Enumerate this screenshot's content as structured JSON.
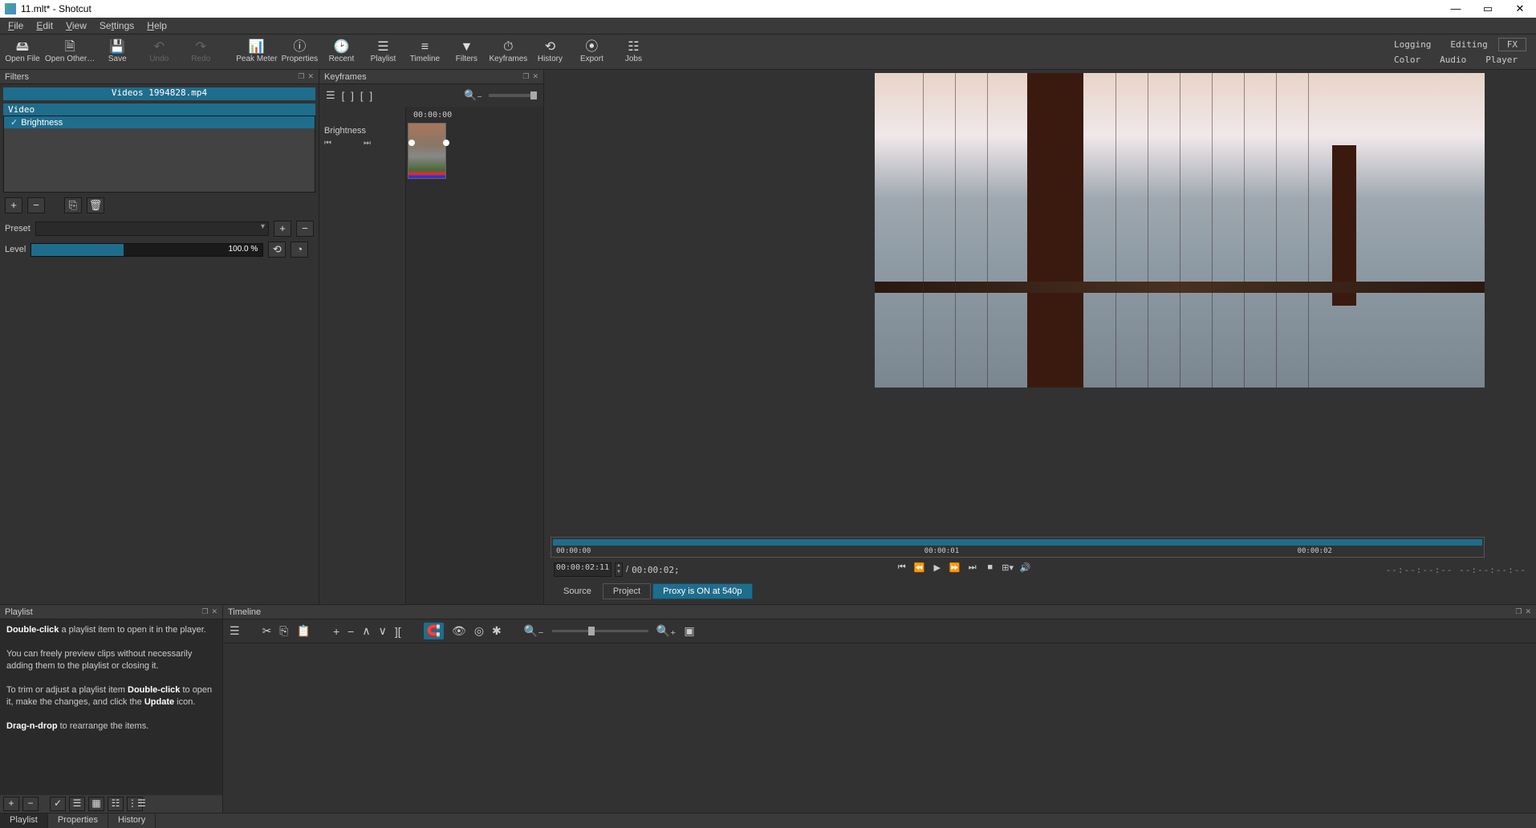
{
  "window": {
    "title": "11.mlt* - Shotcut"
  },
  "menu": {
    "file": "File",
    "edit": "Edit",
    "view": "View",
    "settings": "Settings",
    "help": "Help"
  },
  "toolbar": {
    "open_file": "Open File",
    "open_other": "Open Other…",
    "save": "Save",
    "undo": "Undo",
    "redo": "Redo",
    "peak_meter": "Peak Meter",
    "properties": "Properties",
    "recent": "Recent",
    "playlist": "Playlist",
    "timeline": "Timeline",
    "filters": "Filters",
    "keyframes": "Keyframes",
    "history": "History",
    "export": "Export",
    "jobs": "Jobs"
  },
  "right_tabs": {
    "logging": "Logging",
    "editing": "Editing",
    "fx": "FX",
    "color": "Color",
    "audio": "Audio",
    "player": "Player"
  },
  "filters": {
    "panel_title": "Filters",
    "file": "Videos 1994828.mp4",
    "category": "Video",
    "items": [
      "Brightness"
    ],
    "preset_label": "Preset",
    "level_label": "Level",
    "level_value": "100.0 %"
  },
  "keyframes": {
    "panel_title": "Keyframes",
    "timecode": "00:00:00",
    "filter_name": "Brightness"
  },
  "player": {
    "scrub": {
      "t0": "00:00:00",
      "t1": "00:00:01",
      "t2": "00:00:02"
    },
    "current": "00:00:02:11",
    "total": "00:00:02;",
    "sep": "/",
    "tabs": {
      "source": "Source",
      "project": "Project",
      "proxy": "Proxy is ON at 540p"
    },
    "dashes": "--:--:--:-- --:--:--:--"
  },
  "playlist": {
    "panel_title": "Playlist",
    "line1a": "Double-click",
    "line1b": " a playlist item to open it in the player.",
    "line2": "You can freely preview clips without necessarily adding them to the playlist or closing it.",
    "line3a": "To trim or adjust a playlist item ",
    "line3b": "Double-click",
    "line3c": " to open it, make the changes, and click the ",
    "line3d": "Update",
    "line3e": " icon.",
    "line4a": "Drag-n-drop",
    "line4b": " to rearrange the items."
  },
  "timeline": {
    "panel_title": "Timeline"
  },
  "bottom_tabs": {
    "playlist": "Playlist",
    "properties": "Properties",
    "history": "History"
  }
}
